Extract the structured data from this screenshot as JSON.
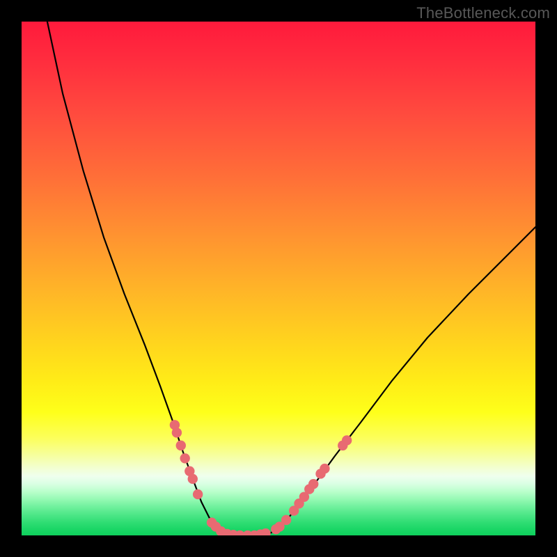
{
  "watermark": "TheBottleneck.com",
  "colors": {
    "curve": "#000000",
    "marker_fill": "#e86a72",
    "marker_stroke": "#d85862",
    "background_frame": "#000000"
  },
  "chart_data": {
    "type": "line",
    "title": "",
    "xlabel": "",
    "ylabel": "",
    "xlim": [
      0,
      100
    ],
    "ylim": [
      0,
      100
    ],
    "grid": false,
    "legend": false,
    "series": [
      {
        "name": "left-branch",
        "x": [
          5,
          8,
          12,
          16,
          20,
          24,
          27,
          29.5,
          31.5,
          33.5,
          35,
          36.5,
          38,
          39,
          40
        ],
        "y": [
          100,
          86,
          71,
          58,
          47,
          37,
          29,
          22,
          16,
          10.5,
          6.5,
          3.5,
          1.5,
          0.5,
          0
        ]
      },
      {
        "name": "floor",
        "x": [
          40,
          41,
          42,
          43,
          44,
          45,
          46,
          47
        ],
        "y": [
          0,
          0,
          0,
          0,
          0,
          0,
          0,
          0
        ]
      },
      {
        "name": "right-branch",
        "x": [
          47,
          48.5,
          50,
          52,
          54,
          57,
          61,
          66,
          72,
          79,
          87,
          95,
          100
        ],
        "y": [
          0,
          0.5,
          1.5,
          3.5,
          6,
          10,
          15.5,
          22,
          30,
          38.5,
          47,
          55,
          60
        ]
      }
    ],
    "markers": [
      {
        "x": 29.8,
        "y": 21.5
      },
      {
        "x": 30.2,
        "y": 20.0
      },
      {
        "x": 31.0,
        "y": 17.5
      },
      {
        "x": 31.8,
        "y": 15.0
      },
      {
        "x": 32.7,
        "y": 12.5
      },
      {
        "x": 33.3,
        "y": 11.0
      },
      {
        "x": 34.3,
        "y": 8.0
      },
      {
        "x": 37.0,
        "y": 2.5
      },
      {
        "x": 37.8,
        "y": 1.7
      },
      {
        "x": 38.8,
        "y": 0.8
      },
      {
        "x": 40.0,
        "y": 0.3
      },
      {
        "x": 41.2,
        "y": 0.1
      },
      {
        "x": 42.5,
        "y": 0.0
      },
      {
        "x": 44.0,
        "y": 0.0
      },
      {
        "x": 45.3,
        "y": 0.0
      },
      {
        "x": 46.5,
        "y": 0.2
      },
      {
        "x": 47.5,
        "y": 0.4
      },
      {
        "x": 49.5,
        "y": 1.2
      },
      {
        "x": 50.2,
        "y": 1.7
      },
      {
        "x": 51.5,
        "y": 3.0
      },
      {
        "x": 53.0,
        "y": 4.8
      },
      {
        "x": 54.0,
        "y": 6.2
      },
      {
        "x": 55.0,
        "y": 7.5
      },
      {
        "x": 56.0,
        "y": 9.0
      },
      {
        "x": 56.8,
        "y": 10.0
      },
      {
        "x": 58.2,
        "y": 12.0
      },
      {
        "x": 59.0,
        "y": 13.0
      },
      {
        "x": 62.5,
        "y": 17.5
      },
      {
        "x": 63.3,
        "y": 18.5
      }
    ]
  }
}
